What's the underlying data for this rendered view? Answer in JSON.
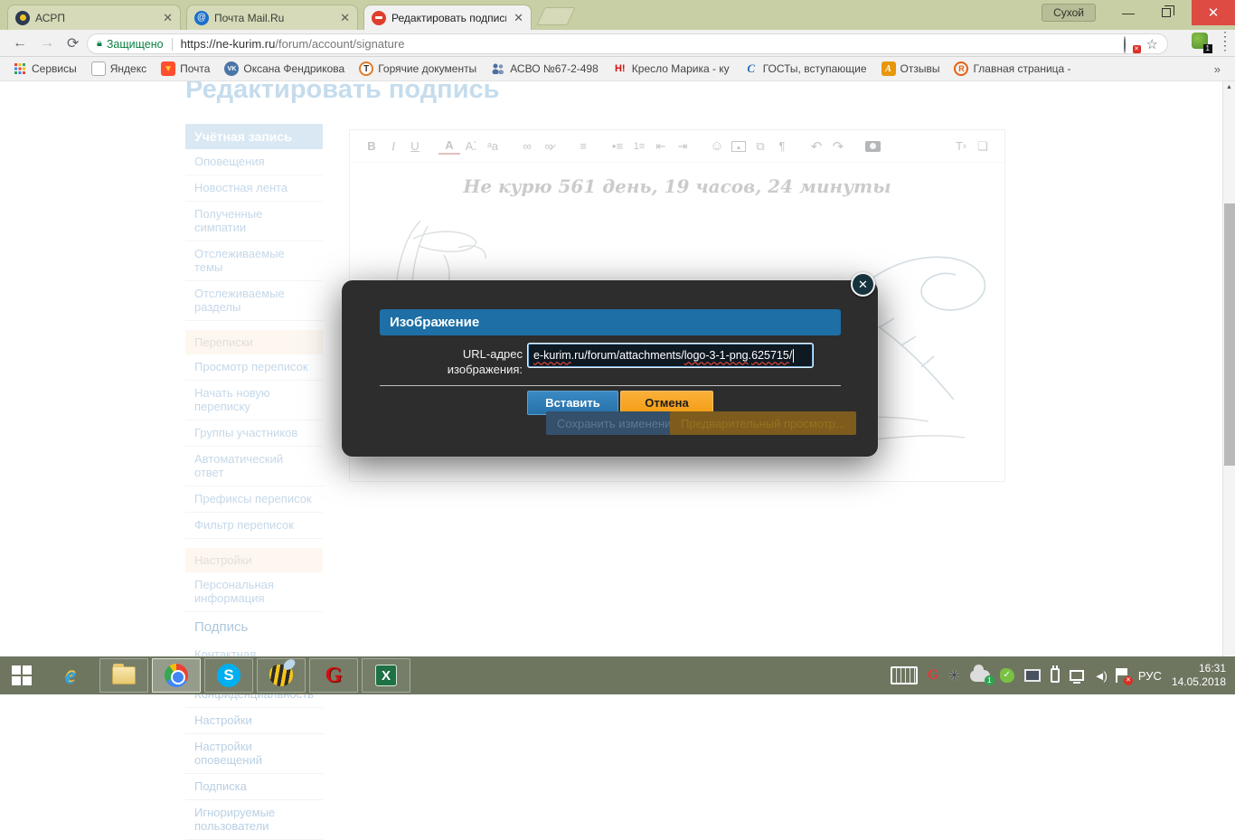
{
  "window": {
    "profile_button": "Сухой"
  },
  "tabs": [
    {
      "title": "АСРП"
    },
    {
      "title": "Почта Mail.Ru"
    },
    {
      "title": "Редактировать подпись"
    }
  ],
  "address_bar": {
    "security_label": "Защищено",
    "url_host": "https://ne-kurim.ru",
    "url_path": "/forum/account/signature",
    "extension_badge": "1"
  },
  "bookmarks": {
    "overflow": "»",
    "items": [
      {
        "icon": "apps-grid",
        "label": "Сервисы"
      },
      {
        "icon": "page",
        "label": "Яндекс"
      },
      {
        "icon": "mail",
        "label": "Почта"
      },
      {
        "icon": "vk",
        "label": "Оксана Фендрикова"
      },
      {
        "icon": "t-circle",
        "label": "Горячие документы"
      },
      {
        "icon": "people",
        "label": "АСВО №67-2-498"
      },
      {
        "icon": "h-red",
        "label": "Кресло Марика - ку"
      },
      {
        "icon": "c-blue",
        "label": "ГОСТы, вступающие"
      },
      {
        "icon": "a-orange",
        "label": "Отзывы"
      },
      {
        "icon": "r-orange",
        "label": "Главная страница -"
      }
    ]
  },
  "page": {
    "title": "Редактировать подпись",
    "sidebar": {
      "groups": [
        {
          "header": "Учётная запись",
          "style": "blue",
          "items": [
            {
              "label": "Оповещения"
            },
            {
              "label": "Новостная лента"
            },
            {
              "label": "Полученные симпатии"
            },
            {
              "label": "Отслеживаемые темы"
            },
            {
              "label": "Отслеживаемые разделы"
            }
          ]
        },
        {
          "header": "Переписки",
          "style": "peach",
          "items": [
            {
              "label": "Просмотр переписок"
            },
            {
              "label": "Начать новую переписку"
            },
            {
              "label": "Группы участников"
            },
            {
              "label": "Автоматический ответ"
            },
            {
              "label": "Префиксы переписок"
            },
            {
              "label": "Фильтр переписок"
            }
          ]
        },
        {
          "header": "Настройки",
          "style": "peach",
          "items": [
            {
              "label": "Персональная информация"
            },
            {
              "label": "Подпись",
              "cls": "active"
            },
            {
              "label": "Контактная информация"
            },
            {
              "label": "Конфиденциальность"
            },
            {
              "label": "Настройки"
            },
            {
              "label": "Настройки оповещений"
            },
            {
              "label": "Подписка"
            },
            {
              "label": "Игнорируемые пользователи"
            }
          ]
        }
      ]
    },
    "editor": {
      "signature_line": "Не курю  561 день, 19 часов, 24 минуты",
      "glyphs": {
        "bold": "B",
        "italic": "I",
        "underline": "U",
        "text_color": "A",
        "font_size": "A⁚",
        "font_family": "ᵃa",
        "link": "∞",
        "unlink": "∞̷",
        "align": "≡",
        "ul": "•≡",
        "ol": "1≡",
        "outdent": "⇤",
        "indent": "⇥",
        "smiley": "☺",
        "media": "⧉",
        "code": "¶",
        "undo": "↶",
        "redo": "↷",
        "remove_format": "T",
        "remove_format_sub": "x",
        "drafts": "❏"
      }
    },
    "footer_buttons": {
      "save": "Сохранить изменения",
      "preview": "Предварительный просмотр..."
    }
  },
  "modal": {
    "title": "Изображение",
    "close_glyph": "✕",
    "label_line1": "URL-адрес",
    "label_line2": "изображения:",
    "url_value": "e-kurim.ru/forum/attachments/logo-3-1-png.625715/",
    "url_parts": [
      {
        "t": "e-kurim"
      },
      {
        "t": ".ru/forum/attachments/"
      },
      {
        "t": "logo-3-1-png"
      },
      {
        "t": "."
      },
      {
        "t": "625715"
      },
      {
        "t": "/"
      }
    ],
    "insert_button": "Вставить",
    "cancel_button": "Отмена"
  },
  "taskbar": {
    "language": "РУС",
    "time": "16:31",
    "date": "14.05.2018",
    "cloud_badge": "1",
    "flag_badge": "✕"
  },
  "colors": {
    "titlebar": "#c8cfa5",
    "taskbar": "#6e7660",
    "secure_green": "#0b8043",
    "modal_header_blue": "#1d6fa5",
    "insert_blue": "#2e7cb8",
    "cancel_orange": "#f39c12",
    "sidebar_header_blue": "#b5d2e8",
    "sidebar_header_peach": "#fcf0e3",
    "page_title_blue": "#8fbcdd"
  }
}
